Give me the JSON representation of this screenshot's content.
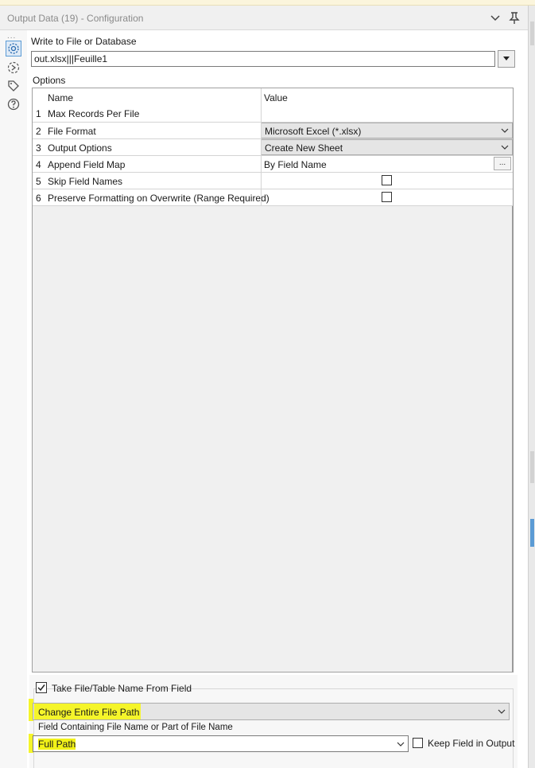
{
  "window": {
    "title": "Output Data (19) - Configuration"
  },
  "sidebar": {
    "items": [
      {
        "icon": "gear-icon",
        "active": true
      },
      {
        "icon": "connection-icon"
      },
      {
        "icon": "tag-icon"
      },
      {
        "icon": "help-icon"
      }
    ],
    "more": "..."
  },
  "write": {
    "label": "Write to File or Database",
    "value": "out.xlsx|||Feuille1"
  },
  "options": {
    "label": "Options",
    "headers": {
      "name": "Name",
      "value": "Value"
    },
    "rows": [
      {
        "num": "1",
        "name": "Max Records Per File",
        "value": ""
      },
      {
        "num": "2",
        "name": "File Format",
        "value": "Microsoft Excel (*.xlsx)"
      },
      {
        "num": "3",
        "name": "Output Options",
        "value": "Create New Sheet"
      },
      {
        "num": "4",
        "name": "Append Field Map",
        "value": "By Field Name",
        "button": "..."
      },
      {
        "num": "5",
        "name": "Skip Field Names",
        "checked": false
      },
      {
        "num": "6",
        "name": "Preserve Formatting on Overwrite (Range Required)",
        "checked": false
      }
    ]
  },
  "take_file": {
    "label": "Take File/Table Name From Field",
    "checked": true,
    "mode_value": "Change Entire File Path",
    "field_label": "Field Containing File Name or Part of File Name",
    "field_value": "Full Path",
    "keep_label": "Keep Field in Output",
    "keep_checked": false
  },
  "colors": {
    "highlight": "#f5f52a",
    "accent": "#5b9bd5"
  }
}
